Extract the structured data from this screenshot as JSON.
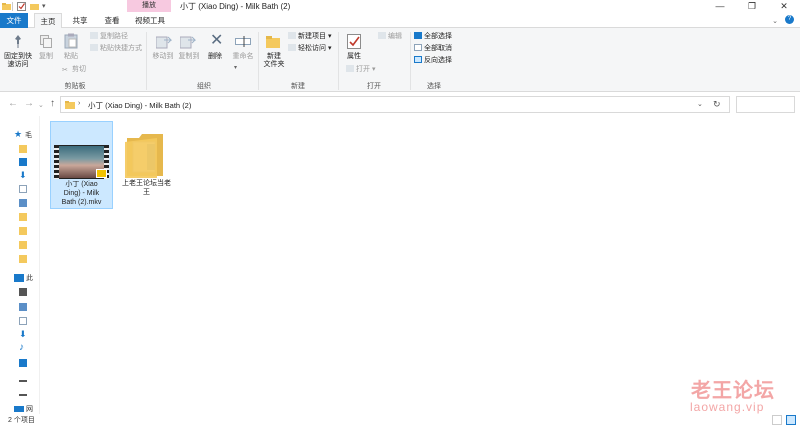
{
  "window": {
    "title": "小丁 (Xiao Ding) - Milk Bath (2)",
    "context_tab": "播放",
    "minimize_glyph": "—",
    "maximize_glyph": "❐",
    "close_glyph": "✕"
  },
  "tabs": [
    {
      "label": "文件"
    },
    {
      "label": "主页"
    },
    {
      "label": "共享"
    },
    {
      "label": "查看"
    },
    {
      "label": "视频工具"
    }
  ],
  "ribbon": {
    "clipboard": {
      "group_label": "剪贴板",
      "pin_label": "固定到快\n速访问",
      "copy_label": "复制",
      "paste_label": "粘贴",
      "copy_path_label": "复制路径",
      "paste_shortcut_label": "粘贴快捷方式",
      "cut_label": "剪切"
    },
    "organize": {
      "group_label": "组织",
      "move_to_label": "移动到",
      "copy_to_label": "复制到",
      "delete_label": "删除",
      "rename_label": "重命名"
    },
    "new": {
      "group_label": "新建",
      "new_folder_label": "新建\n文件夹",
      "new_item_label": "新建项目",
      "easy_access_label": "轻松访问"
    },
    "open": {
      "group_label": "打开",
      "properties_label": "属性",
      "open_label": "打开",
      "edit_label": "编辑"
    },
    "select": {
      "group_label": "选择",
      "select_all_label": "全部选择",
      "select_none_label": "全部取消",
      "invert_selection_label": "反向选择"
    }
  },
  "address": {
    "path": "小丁 (Xiao Ding) - Milk Bath (2)",
    "search_placeholder": ""
  },
  "files": [
    {
      "name": "小丁 (Xiao\nDing) - Milk\nBath (2).mkv",
      "type": "video",
      "icon": "video-thumbnail-icon",
      "selected": true
    },
    {
      "name": "上老王论坛当老\n王",
      "type": "folder",
      "icon": "folder-icon",
      "selected": false
    }
  ],
  "navpane": {
    "quick_access_letter": "毛",
    "this_pc_letter": "此",
    "network_letter": "网"
  },
  "status": {
    "item_count": "2 个项目"
  },
  "watermark": {
    "cn": "老王论坛",
    "url": "laowang.vip"
  },
  "colors": {
    "file_tab": "#1979ca",
    "context_tab": "#f7c9e0",
    "folder": "#f4c95d",
    "selection": "#cce8ff",
    "watermark": "#f3a6a6"
  }
}
